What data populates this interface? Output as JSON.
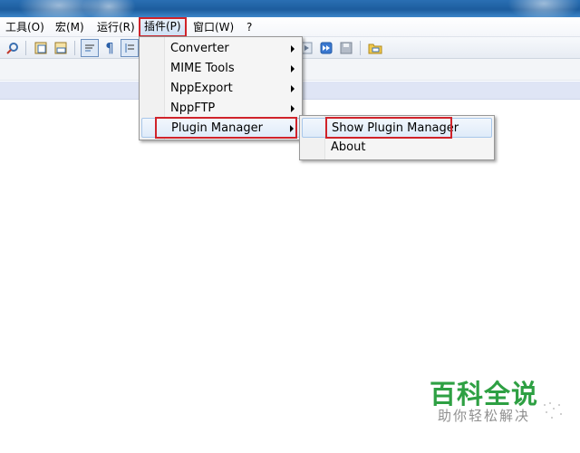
{
  "menubar": {
    "items": [
      {
        "label": "工具(O)"
      },
      {
        "label": "宏(M)"
      },
      {
        "label": "运行(R)"
      },
      {
        "label": "插件(P)"
      },
      {
        "label": "窗口(W)"
      },
      {
        "label": "?"
      }
    ]
  },
  "plugins_menu": {
    "items": [
      {
        "label": "Converter"
      },
      {
        "label": "MIME Tools"
      },
      {
        "label": "NppExport"
      },
      {
        "label": "NppFTP"
      },
      {
        "label": "Plugin Manager"
      }
    ]
  },
  "plugin_manager_submenu": {
    "items": [
      {
        "label": "Show Plugin Manager"
      },
      {
        "label": "About"
      }
    ]
  },
  "watermark": {
    "title": "百科全说",
    "subtitle": "助你轻松解决"
  },
  "colors": {
    "highlight_border": "#d0232a",
    "watermark_green": "#2ea043",
    "title_blue": "#1d5d9e"
  }
}
